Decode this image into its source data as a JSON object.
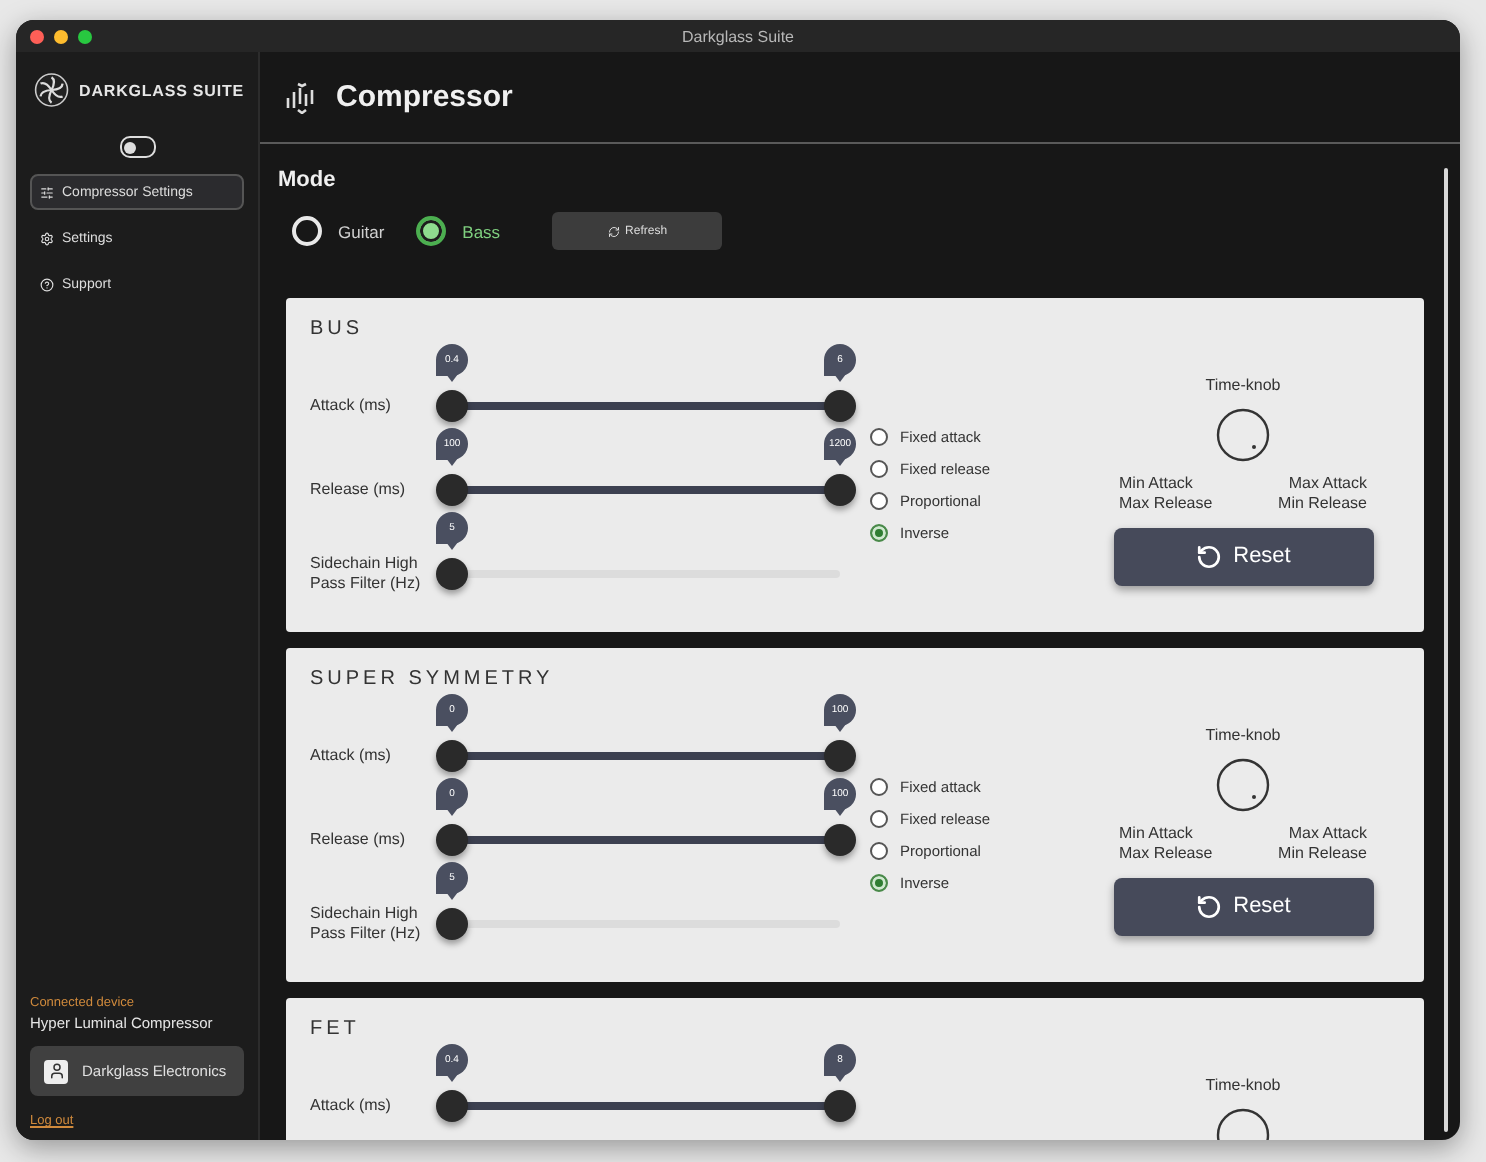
{
  "window": {
    "title": "Darkglass Suite"
  },
  "sidebar": {
    "brand": "DARKGLASS SUITE",
    "toggle": {
      "on": false
    },
    "items": [
      {
        "label": "Compressor Settings",
        "selected": true
      },
      {
        "label": "Settings",
        "selected": false
      },
      {
        "label": "Support",
        "selected": false
      }
    ],
    "device": {
      "caption": "Connected device",
      "name": "Hyper Luminal Compressor"
    },
    "account": {
      "name": "Darkglass Electronics"
    },
    "logout": "Log out"
  },
  "header": {
    "title": "Compressor"
  },
  "mode": {
    "title": "Mode",
    "options": [
      {
        "label": "Guitar",
        "selected": false
      },
      {
        "label": "Bass",
        "selected": true
      }
    ],
    "refresh": "Refresh"
  },
  "cards": [
    {
      "title": "BUS",
      "sliders": [
        {
          "label": "Attack (ms)",
          "kind": "range",
          "thumbs": [
            {
              "value": "0.4",
              "level": 0
            },
            {
              "value": "6",
              "level": 1
            }
          ]
        },
        {
          "label": "Release (ms)",
          "kind": "range",
          "thumbs": [
            {
              "value": "100",
              "level": 0
            },
            {
              "value": "1200",
              "level": 1
            }
          ]
        },
        {
          "label": "Sidechain High Pass Filter (Hz)",
          "kind": "single",
          "thumbs": [
            {
              "value": "5",
              "level": 0
            }
          ]
        }
      ],
      "options": [
        {
          "label": "Fixed attack",
          "selected": false
        },
        {
          "label": "Fixed release",
          "selected": false
        },
        {
          "label": "Proportional",
          "selected": false
        },
        {
          "label": "Inverse",
          "selected": true
        }
      ],
      "knob": {
        "title": "Time-knob",
        "captions": [
          "Min Attack",
          "Max Attack",
          "Max Release",
          "Min Release"
        ]
      },
      "reset": "Reset"
    },
    {
      "title": "SUPER SYMMETRY",
      "sliders": [
        {
          "label": "Attack (ms)",
          "kind": "range",
          "thumbs": [
            {
              "value": "0",
              "level": 0
            },
            {
              "value": "100",
              "level": 1
            }
          ]
        },
        {
          "label": "Release (ms)",
          "kind": "range",
          "thumbs": [
            {
              "value": "0",
              "level": 0
            },
            {
              "value": "100",
              "level": 1
            }
          ]
        },
        {
          "label": "Sidechain High Pass Filter (Hz)",
          "kind": "single",
          "thumbs": [
            {
              "value": "5",
              "level": 0
            }
          ]
        }
      ],
      "options": [
        {
          "label": "Fixed attack",
          "selected": false
        },
        {
          "label": "Fixed release",
          "selected": false
        },
        {
          "label": "Proportional",
          "selected": false
        },
        {
          "label": "Inverse",
          "selected": true
        }
      ],
      "knob": {
        "title": "Time-knob",
        "captions": [
          "Min Attack",
          "Max Attack",
          "Max Release",
          "Min Release"
        ]
      },
      "reset": "Reset"
    },
    {
      "title": "FET",
      "sliders": [
        {
          "label": "Attack (ms)",
          "kind": "range",
          "thumbs": [
            {
              "value": "0.4",
              "level": 0
            },
            {
              "value": "8",
              "level": 1
            }
          ]
        }
      ],
      "knob": {
        "title": "Time-knob"
      }
    }
  ]
}
